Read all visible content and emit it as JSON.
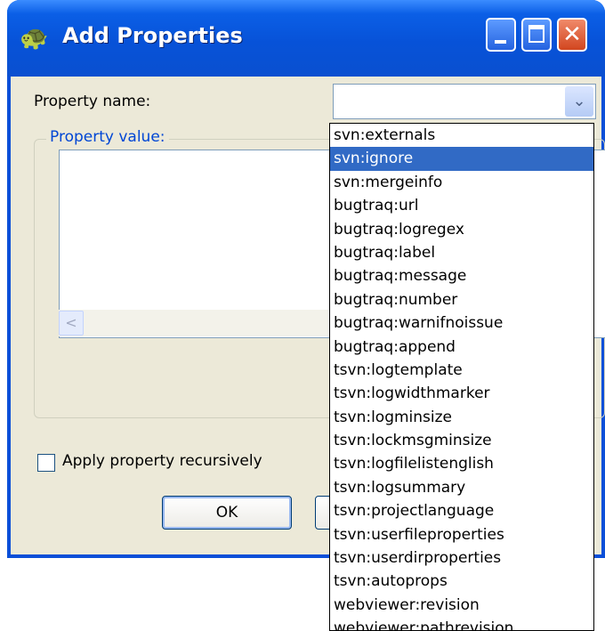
{
  "window": {
    "title": "Add Properties",
    "icon": "tortoise-icon",
    "buttons": [
      "minimize-icon",
      "maximize-icon",
      "close-icon"
    ]
  },
  "form": {
    "property_name_label": "Property name:",
    "property_name_value": "",
    "property_value_label": "Property value:",
    "property_value_text": "",
    "recursive_label": "Apply property recursively",
    "recursive_checked": false,
    "ok_label": "OK"
  },
  "dropdown": {
    "selected_index": 1,
    "items": [
      "svn:externals",
      "svn:ignore",
      "svn:mergeinfo",
      "bugtraq:url",
      "bugtraq:logregex",
      "bugtraq:label",
      "bugtraq:message",
      "bugtraq:number",
      "bugtraq:warnifnoissue",
      "bugtraq:append",
      "tsvn:logtemplate",
      "tsvn:logwidthmarker",
      "tsvn:logminsize",
      "tsvn:lockmsgminsize",
      "tsvn:logfilelistenglish",
      "tsvn:logsummary",
      "tsvn:projectlanguage",
      "tsvn:userfileproperties",
      "tsvn:userdirproperties",
      "tsvn:autoprops",
      "webviewer:revision",
      "webviewer:pathrevision"
    ]
  },
  "colors": {
    "titlebar": "#0752d8",
    "selection": "#316ac5",
    "group_title": "#0046d5",
    "dialog_bg": "#ece9d8"
  }
}
